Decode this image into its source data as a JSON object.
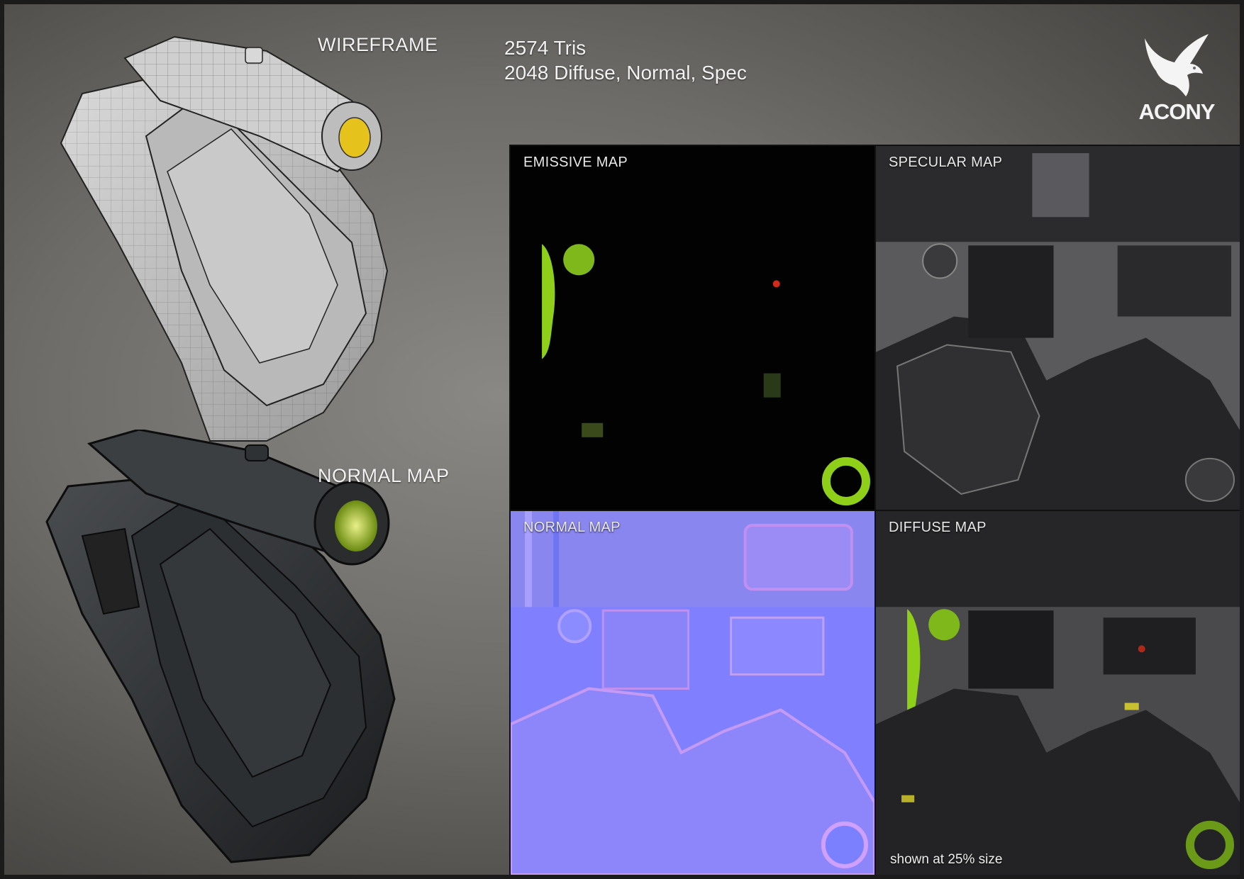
{
  "labels": {
    "wireframe": "WIREFRAME",
    "normal_render": "NORMAL MAP"
  },
  "stats": {
    "tris": "2574 Tris",
    "textures": "2048 Diffuse, Normal, Spec"
  },
  "logo": {
    "text": "ACONY",
    "icon": "eagle-icon"
  },
  "maps": {
    "emissive": "EMISSIVE MAP",
    "specular": "SPECULAR MAP",
    "normal": "NORMAL MAP",
    "diffuse": "DIFFUSE MAP",
    "note": "shown at 25% size"
  },
  "colors": {
    "emissive_green": "#8fcf1a",
    "normal_base": "#8080ff",
    "lens_yellow": "#d8c020"
  }
}
